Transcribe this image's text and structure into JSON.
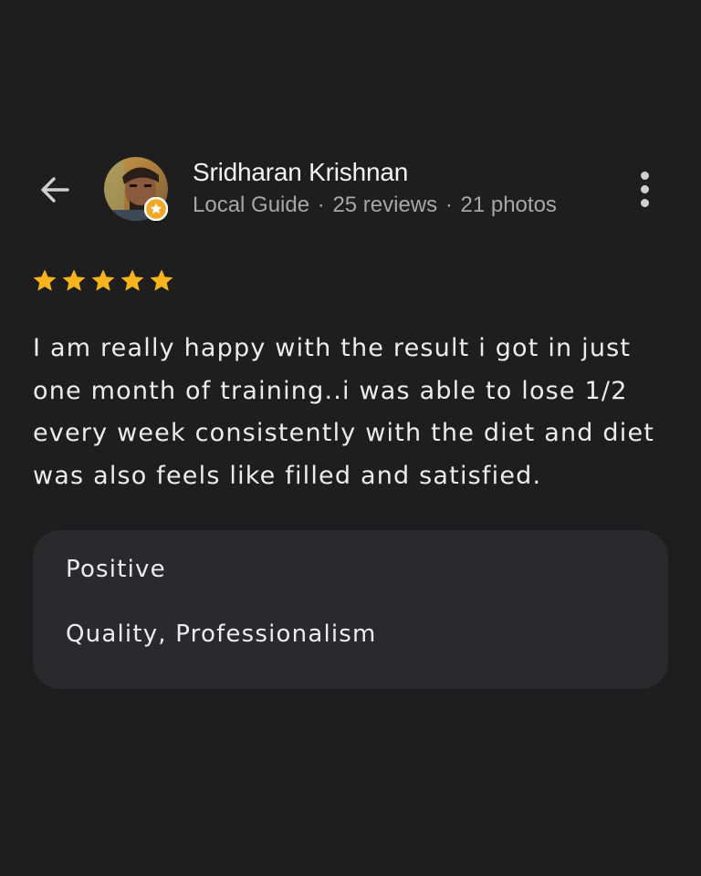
{
  "header": {
    "back_icon": "arrow-left-icon",
    "more_icon": "more-vert-icon"
  },
  "reviewer": {
    "name": "Sridharan Krishnan",
    "badge": "Local Guide",
    "separator": "·",
    "reviews": "25 reviews",
    "photos": "21 photos",
    "badge_icon": "local-guide-star-icon"
  },
  "rating": {
    "stars": 5,
    "max": 5,
    "star_color": "#f9b31b"
  },
  "review": {
    "text": "I am really happy with the result i got in just one month of training..i was able to lose 1/2 every week consistently with the diet and diet was also feels like filled and satisfied."
  },
  "tags": {
    "title": "Positive",
    "values": "Quality, Professionalism"
  },
  "colors": {
    "background": "#1e1e1e",
    "card": "#2a2a2c",
    "primary_text": "#ececec",
    "secondary_text": "#a7a7a7",
    "badge": "#f5a623"
  }
}
